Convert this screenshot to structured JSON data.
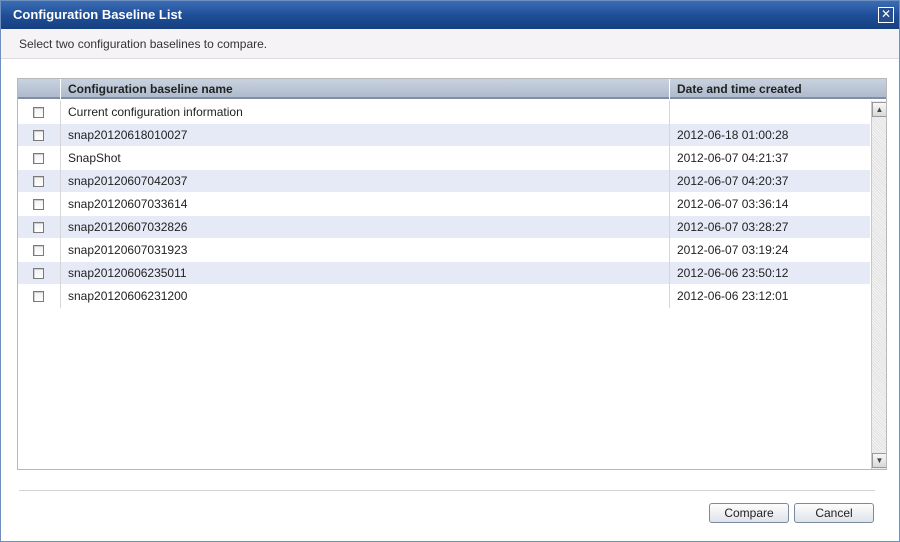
{
  "window": {
    "title": "Configuration Baseline List",
    "close_icon": "close-icon",
    "close_glyph": "✕"
  },
  "instruction": "Select two configuration baselines to compare.",
  "table": {
    "columns": [
      "",
      "Configuration baseline name",
      "Date and time created"
    ],
    "rows": [
      {
        "name": "Current configuration information",
        "date": "",
        "checked": false
      },
      {
        "name": "snap20120618010027",
        "date": "2012-06-18 01:00:28",
        "checked": false
      },
      {
        "name": "SnapShot",
        "date": "2012-06-07 04:21:37",
        "checked": false
      },
      {
        "name": "snap20120607042037",
        "date": "2012-06-07 04:20:37",
        "checked": false
      },
      {
        "name": "snap20120607033614",
        "date": "2012-06-07 03:36:14",
        "checked": false
      },
      {
        "name": "snap20120607032826",
        "date": "2012-06-07 03:28:27",
        "checked": false
      },
      {
        "name": "snap20120607031923",
        "date": "2012-06-07 03:19:24",
        "checked": false
      },
      {
        "name": "snap20120606235011",
        "date": "2012-06-06 23:50:12",
        "checked": false
      },
      {
        "name": "snap20120606231200",
        "date": "2012-06-06 23:12:01",
        "checked": false
      }
    ]
  },
  "scrollbar": {
    "up_glyph": "▲",
    "down_glyph": "▼"
  },
  "buttons": {
    "compare": "Compare",
    "cancel": "Cancel"
  },
  "colors": {
    "titlebar": "#1f4f98",
    "row_alt": "#e6e9f6",
    "header": "#aebbcd"
  }
}
